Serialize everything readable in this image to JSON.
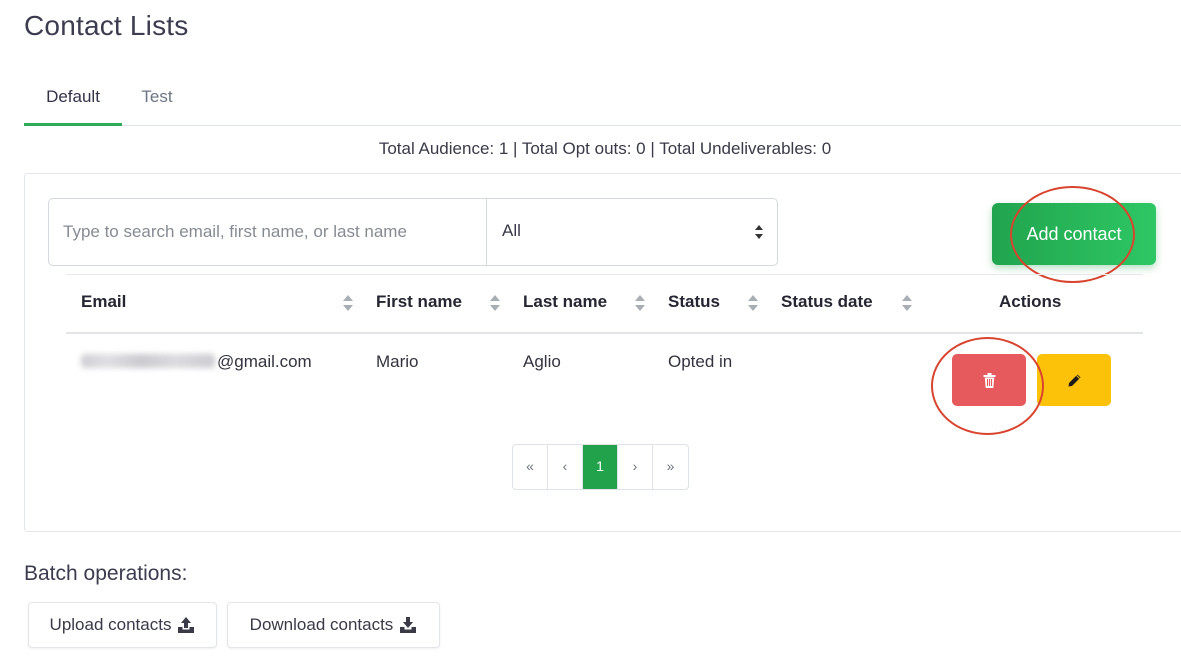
{
  "page": {
    "title": "Contact Lists"
  },
  "tabs": [
    {
      "label": "Default",
      "active": true
    },
    {
      "label": "Test",
      "active": false
    }
  ],
  "summary": {
    "text": "Total Audience: 1 | Total Opt outs: 0 | Total Undeliverables: 0"
  },
  "filters": {
    "search_placeholder": "Type to search email, first name, or last name",
    "search_value": "",
    "status_select_value": "All"
  },
  "add_contact_label": "Add contact",
  "table": {
    "headers": [
      "Email",
      "First name",
      "Last name",
      "Status",
      "Status date",
      "Actions"
    ],
    "rows": [
      {
        "email_visible": "@gmail.com",
        "first_name": "Mario",
        "last_name": "Aglio",
        "status": "Opted in",
        "status_date": ""
      }
    ]
  },
  "pagination": {
    "first": "«",
    "prev": "‹",
    "current": "1",
    "next": "›",
    "last": "»"
  },
  "batch": {
    "title": "Batch operations:",
    "upload_label": "Upload contacts",
    "download_label": "Download contacts"
  },
  "colors": {
    "accent_green": "#22a34b",
    "danger": "#e65a5e",
    "warning": "#fcc20a",
    "annotation": "#d9442f"
  },
  "icons": [
    "sort-icon",
    "select-arrows-icon",
    "trash-icon",
    "pencil-icon",
    "upload-icon",
    "download-icon"
  ]
}
